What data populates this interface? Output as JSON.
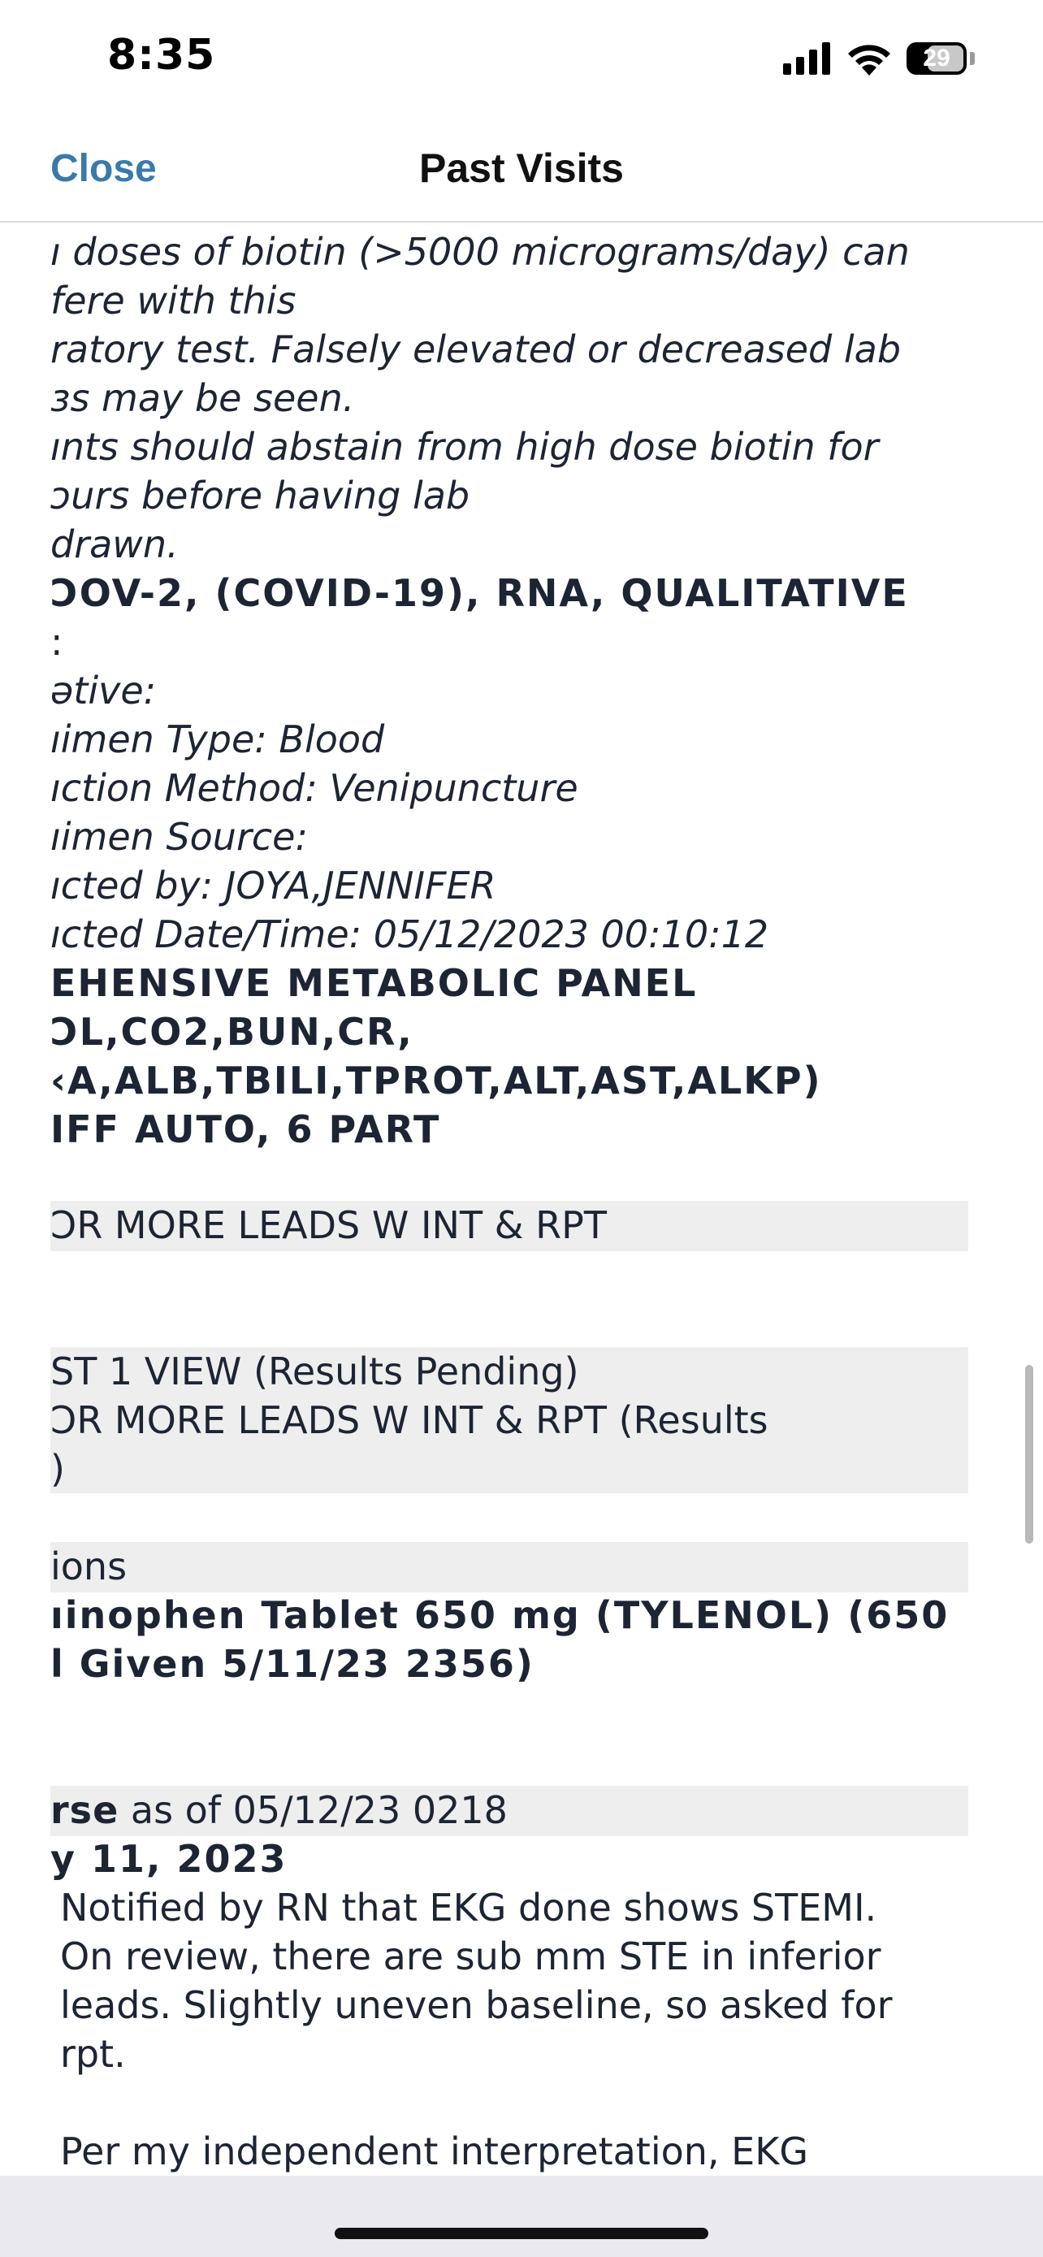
{
  "status_bar": {
    "time": "8:35",
    "battery": "29",
    "icons": [
      "cellular-signal-icon",
      "wifi-icon",
      "battery-icon"
    ]
  },
  "nav": {
    "close_label": "Close",
    "title": "Past Visits"
  },
  "content": {
    "biotin_note": [
      "ı doses of biotin (>5000 micrograms/day) can",
      "fere with this",
      "ratory test. Falsely elevated or decreased lab",
      "зs may be seen.",
      "ınts should abstain from high dose biotin for",
      "ɔurs before having lab",
      " drawn."
    ],
    "covid_header": "ƆOV-2, (COVID-19), RNA, QUALITATIVE",
    "covid_marker": ":",
    "covid_details": [
      "ətive:",
      "ıimen Type: Blood",
      "ıction Method: Venipuncture",
      "ıimen Source:",
      "ıcted by: JOYA,JENNIFER",
      "ıcted Date/Time: 05/12/2023 00:10:12"
    ],
    "panel_lines": [
      "EHENSIVE METABOLIC PANEL",
      "ƆL,CO2,BUN,CR,",
      "‹A,ALB,TBILI,TPROT,ALT,AST,ALKP)",
      "IFF AUTO, 6 PART"
    ],
    "ekg_band_1": "ƆR MORE LEADS W INT & RPT",
    "pending_band": [
      "ST 1 VIEW    (Results Pending)",
      "ƆR MORE LEADS W INT & RPT    (Results",
      ")"
    ],
    "medications_band": "ions",
    "medication_lines": [
      "ıinophen Tablet 650 mg (TYLENOL) (650",
      "l Given 5/11/23 2356)"
    ],
    "course_band": {
      "bold": "rse",
      "rest": " as of 05/12/23 0218"
    },
    "course_date": "y 11, 2023",
    "course_note": [
      "Notified by RN that EKG done shows STEMI.",
      "On review, there are sub mm STE in inferior",
      "leads. Slightly uneven baseline, so asked for",
      "rpt.",
      "",
      "Per my independent interpretation, EKG"
    ]
  },
  "colors": {
    "link": "#3a7aa8",
    "band": "#eeeeee",
    "text": "#1d2433"
  }
}
